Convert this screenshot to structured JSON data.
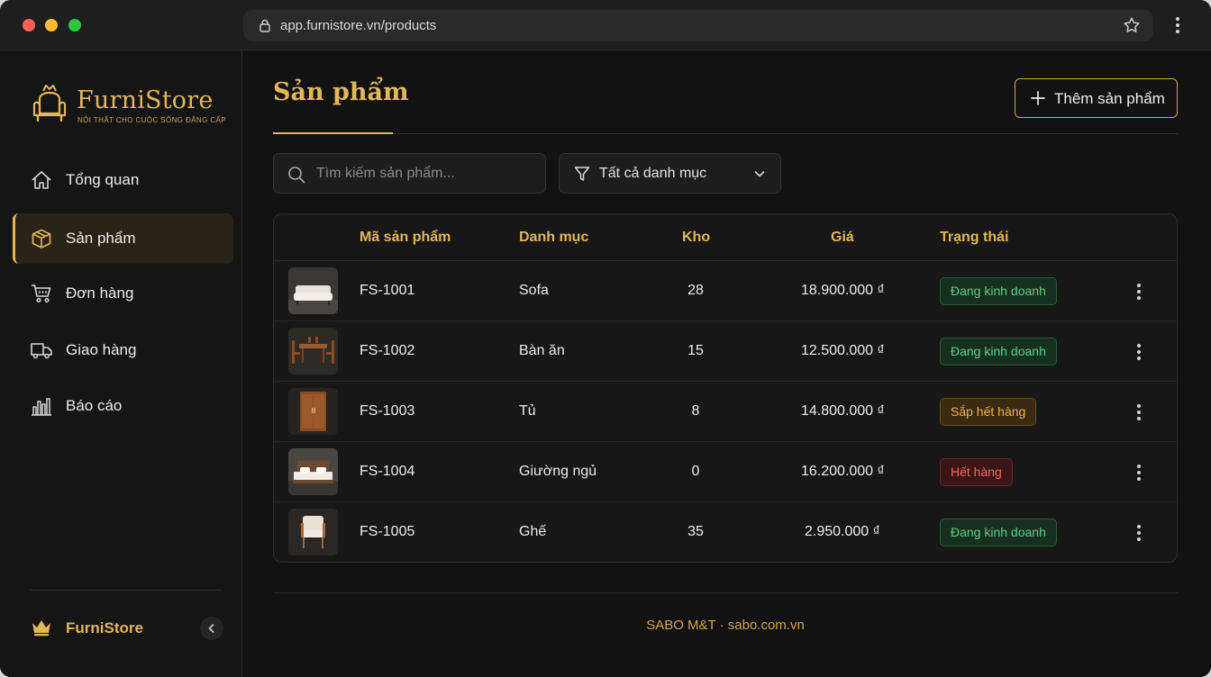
{
  "browser": {
    "url": "app.furnistore.vn/products"
  },
  "sidebar": {
    "brand": "FurniStore",
    "tagline": "NỘI THẤT CHO CUỘC SỐNG ĐẲNG CẤP",
    "items": [
      {
        "label": "Tổng quan",
        "icon": "home-icon"
      },
      {
        "label": "Sản phẩm",
        "icon": "box-icon",
        "active": true
      },
      {
        "label": "Đơn hàng",
        "icon": "cart-icon"
      },
      {
        "label": "Giao hàng",
        "icon": "truck-icon"
      },
      {
        "label": "Báo cáo",
        "icon": "chart-icon"
      }
    ],
    "footer_name": "FurniStore"
  },
  "main": {
    "title": "Sản phẩm",
    "add_button": "Thêm sản phẩm",
    "search_placeholder": "Tìm kiếm sản phẩm...",
    "filter_label": "Tất cả danh mục",
    "columns": [
      "Mã sản phẩm",
      "Danh mục",
      "Kho",
      "Giá",
      "Trạng thái"
    ],
    "rows": [
      {
        "code": "FS-1001",
        "category": "Sofa",
        "stock": "28",
        "price": "18.900.000 ₫",
        "status": "Đang kinh doanh",
        "status_type": "active"
      },
      {
        "code": "FS-1002",
        "category": "Bàn ăn",
        "stock": "15",
        "price": "12.500.000 ₫",
        "status": "Đang kinh doanh",
        "status_type": "active"
      },
      {
        "code": "FS-1003",
        "category": "Tủ",
        "stock": "8",
        "price": "14.800.000 ₫",
        "status": "Sắp hết hàng",
        "status_type": "low"
      },
      {
        "code": "FS-1004",
        "category": "Giường ngủ",
        "stock": "0",
        "price": "16.200.000 ₫",
        "status": "Hết hàng",
        "status_type": "out"
      },
      {
        "code": "FS-1005",
        "category": "Ghế",
        "stock": "35",
        "price": "2.950.000 ₫",
        "status": "Đang kinh doanh",
        "status_type": "active"
      }
    ],
    "footer": "SABO M&T · sabo.com.vn"
  },
  "colors": {
    "accent": "#e3b65a",
    "background": "#121212",
    "status_active": "#5fd08a",
    "status_low": "#f0b44c",
    "status_out": "#f06a5a"
  }
}
